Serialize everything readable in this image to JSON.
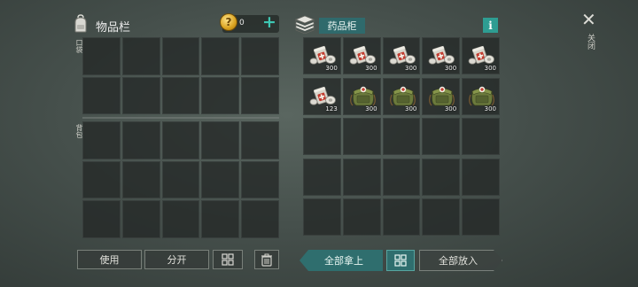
{
  "inventory": {
    "title": "物品栏",
    "coins": "0",
    "coin_symbol": "?",
    "add_symbol": "+",
    "pocket_label": "口袋",
    "backpack_label": "背包",
    "use_label": "使用",
    "split_label": "分开"
  },
  "cabinet": {
    "title": "药品柜",
    "info_symbol": "i",
    "take_all_label": "全部拿上",
    "put_all_label": "全部放入",
    "items": [
      {
        "type": "bandage-icon",
        "qty": "300"
      },
      {
        "type": "bandage-icon",
        "qty": "300"
      },
      {
        "type": "bandage-icon",
        "qty": "300"
      },
      {
        "type": "bandage-icon",
        "qty": "300"
      },
      {
        "type": "bandage-icon",
        "qty": "300"
      },
      {
        "type": "bandage-icon",
        "qty": "123"
      },
      {
        "type": "medkit-bag-icon",
        "qty": "300"
      },
      {
        "type": "medkit-bag-icon",
        "qty": "300"
      },
      {
        "type": "medkit-bag-icon",
        "qty": "300"
      },
      {
        "type": "medkit-bag-icon",
        "qty": "300"
      }
    ]
  },
  "close": {
    "symbol": "✕",
    "label": "关闭"
  },
  "colors": {
    "accent_teal": "#2f6e6e",
    "info_teal": "#2e9d92",
    "plus_teal": "#3ec7b3",
    "coin_gold": "#d9a21f"
  }
}
